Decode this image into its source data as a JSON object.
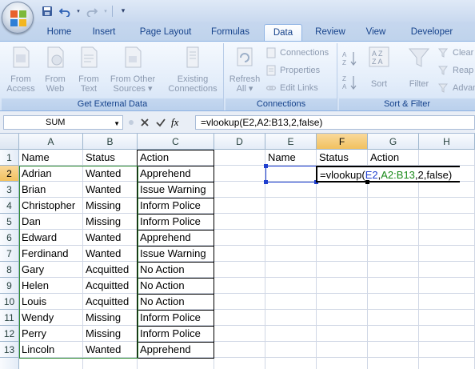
{
  "ribbon": {
    "tabs": [
      "Home",
      "Insert",
      "Page Layout",
      "Formulas",
      "Data",
      "Review",
      "View",
      "Developer"
    ],
    "active_tab": "Data",
    "groups": {
      "external": {
        "label": "Get External Data",
        "buttons": [
          {
            "line1": "From",
            "line2": "Access"
          },
          {
            "line1": "From",
            "line2": "Web"
          },
          {
            "line1": "From",
            "line2": "Text"
          },
          {
            "line1": "From Other",
            "line2": "Sources ▾"
          },
          {
            "line1": "Existing",
            "line2": "Connections"
          }
        ]
      },
      "connections": {
        "label": "Connections",
        "refresh": {
          "line1": "Refresh",
          "line2": "All ▾"
        },
        "items": [
          "Connections",
          "Properties",
          "Edit Links"
        ]
      },
      "sort_filter": {
        "label": "Sort & Filter",
        "sort_label": "Sort",
        "filter_label": "Filter",
        "small": [
          "Clear",
          "Reap",
          "Advan"
        ]
      }
    }
  },
  "formula_bar": {
    "name_box": "SUM",
    "fx": "fx",
    "formula": "=vlookup(E2,A2:B13,2,false)"
  },
  "grid": {
    "columns": [
      "A",
      "B",
      "C",
      "D",
      "E",
      "F",
      "G",
      "H"
    ],
    "rows": [
      "1",
      "2",
      "3",
      "4",
      "5",
      "6",
      "7",
      "8",
      "9",
      "10",
      "11",
      "12",
      "13"
    ],
    "selected_column": "F",
    "selected_row": "2",
    "table": [
      [
        "Name",
        "Status",
        "Action"
      ],
      [
        "Adrian",
        "Wanted",
        "Apprehend"
      ],
      [
        "Brian",
        "Wanted",
        "Issue Warning"
      ],
      [
        "Christopher",
        "Missing",
        "Inform Police"
      ],
      [
        "Dan",
        "Missing",
        "Inform Police"
      ],
      [
        "Edward",
        "Wanted",
        "Apprehend"
      ],
      [
        "Ferdinand",
        "Wanted",
        "Issue Warning"
      ],
      [
        "Gary",
        "Acquitted",
        "No Action"
      ],
      [
        "Helen",
        "Acquitted",
        "No Action"
      ],
      [
        "Louis",
        "Acquitted",
        "No Action"
      ],
      [
        "Wendy",
        "Missing",
        "Inform Police"
      ],
      [
        "Perry",
        "Missing",
        "Inform Police"
      ],
      [
        "Lincoln",
        "Wanted",
        "Apprehend"
      ]
    ],
    "lookup_headers": [
      "Name",
      "Status",
      "Action"
    ],
    "editing_cell": {
      "prefix": "=vlookup(",
      "ref1": "E2",
      "sep1": ",",
      "ref2": "A2:B13",
      "suffix": ",2,false)"
    },
    "ref1_color": "#1f3fcf",
    "ref2_color": "#1a8a1a"
  }
}
